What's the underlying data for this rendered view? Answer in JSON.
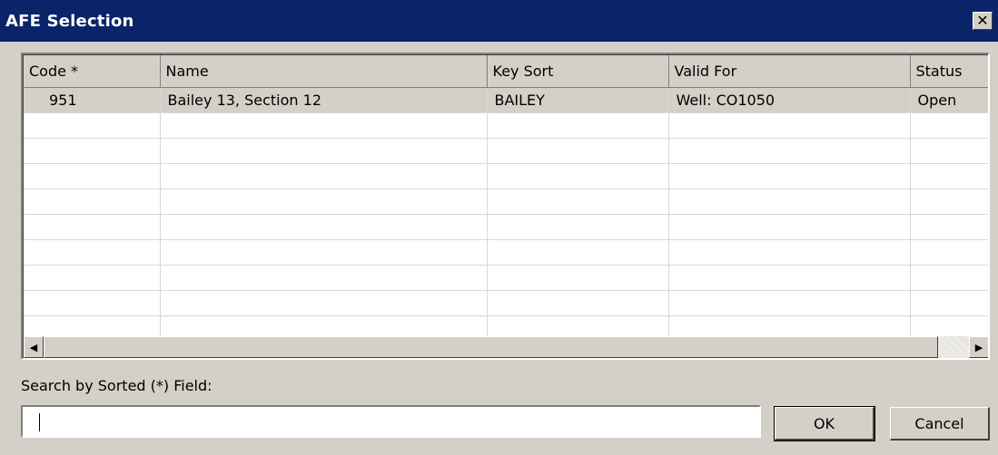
{
  "window": {
    "title": "AFE Selection",
    "close_glyph": "✕"
  },
  "grid": {
    "columns": [
      "Code *",
      "Name",
      "Key Sort",
      "Valid For",
      "Status"
    ],
    "rows": [
      {
        "code": "951",
        "name": "Bailey 13, Section 12",
        "key_sort": "BAILEY",
        "valid_for": "Well: CO1050",
        "status": "Open"
      }
    ],
    "empty_rows": 9
  },
  "scrollbar": {
    "left_arrow": "◀",
    "right_arrow": "▶"
  },
  "search": {
    "label": "Search by Sorted (*)  Field:",
    "value": ""
  },
  "buttons": {
    "ok": "OK",
    "cancel": "Cancel"
  },
  "colors": {
    "titlebar": "#0a246a",
    "dialog_bg": "#d4d0c8"
  }
}
